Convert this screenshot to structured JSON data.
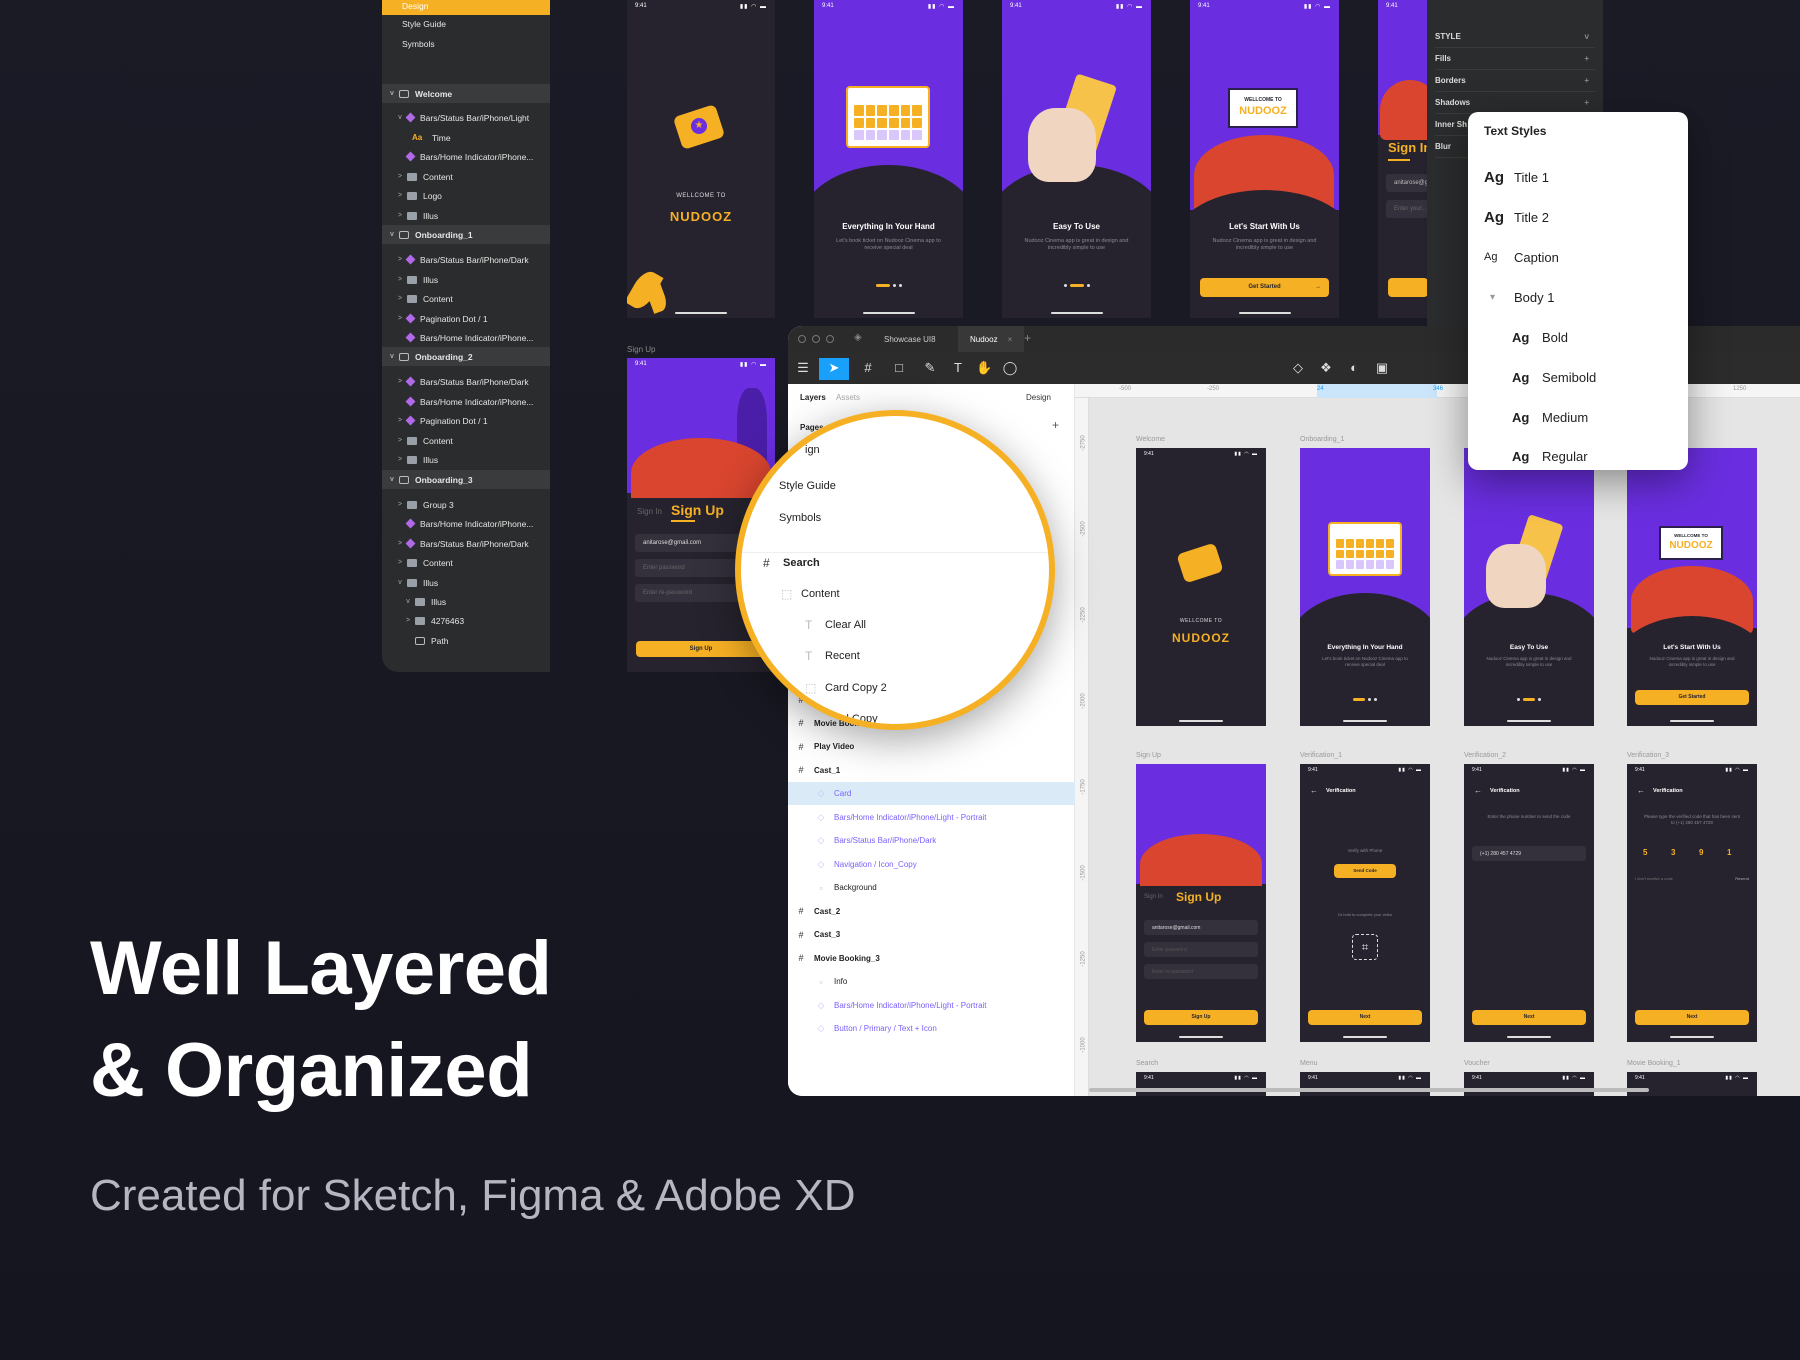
{
  "sketch_layers": {
    "top_selected": "Design",
    "pages": [
      "Style Guide",
      "Symbols"
    ],
    "rows": [
      {
        "type": "group",
        "label": "Welcome"
      },
      {
        "type": "symbol",
        "label": "Bars/Status Bar/iPhone/Light",
        "indent": 1,
        "arrow": "v"
      },
      {
        "type": "text",
        "label": "Time",
        "indent": 2
      },
      {
        "type": "symbol",
        "label": "Bars/Home Indicator/iPhone...",
        "indent": 1
      },
      {
        "type": "folder",
        "label": "Content",
        "indent": 1,
        "arrow": ">"
      },
      {
        "type": "folder",
        "label": "Logo",
        "indent": 1,
        "arrow": ">"
      },
      {
        "type": "folder",
        "label": "Illus",
        "indent": 1,
        "arrow": ">"
      },
      {
        "type": "group",
        "label": "Onboarding_1"
      },
      {
        "type": "symbol",
        "label": "Bars/Status Bar/iPhone/Dark",
        "indent": 1,
        "arrow": ">"
      },
      {
        "type": "folder",
        "label": "Illus",
        "indent": 1,
        "arrow": ">"
      },
      {
        "type": "folder",
        "label": "Content",
        "indent": 1,
        "arrow": ">"
      },
      {
        "type": "symbol",
        "label": "Pagination Dot / 1",
        "indent": 1,
        "arrow": ">"
      },
      {
        "type": "symbol",
        "label": "Bars/Home Indicator/iPhone...",
        "indent": 1
      },
      {
        "type": "group",
        "label": "Onboarding_2"
      },
      {
        "type": "symbol",
        "label": "Bars/Status Bar/iPhone/Dark",
        "indent": 1,
        "arrow": ">"
      },
      {
        "type": "symbol",
        "label": "Bars/Home Indicator/iPhone...",
        "indent": 1
      },
      {
        "type": "symbol",
        "label": "Pagination Dot / 1",
        "indent": 1,
        "arrow": ">"
      },
      {
        "type": "folder",
        "label": "Content",
        "indent": 1,
        "arrow": ">"
      },
      {
        "type": "folder",
        "label": "Illus",
        "indent": 1,
        "arrow": ">"
      },
      {
        "type": "group",
        "label": "Onboarding_3"
      },
      {
        "type": "folder",
        "label": "Group 3",
        "indent": 1,
        "arrow": ">"
      },
      {
        "type": "symbol",
        "label": "Bars/Home Indicator/iPhone...",
        "indent": 1
      },
      {
        "type": "symbol",
        "label": "Bars/Status Bar/iPhone/Dark",
        "indent": 1,
        "arrow": ">"
      },
      {
        "type": "folder",
        "label": "Content",
        "indent": 1,
        "arrow": ">"
      },
      {
        "type": "folder",
        "label": "Illus",
        "indent": 1,
        "arrow": "v"
      },
      {
        "type": "folder",
        "label": "Illus",
        "indent": 2,
        "arrow": "v"
      },
      {
        "type": "folder",
        "label": "4276463",
        "indent": 2,
        "arrow": ">"
      },
      {
        "type": "path",
        "label": "Path",
        "indent": 2
      }
    ]
  },
  "phones_top": {
    "status_time": "9:41",
    "welcome_small": "WELLCOME TO",
    "brand": "NUDOOZ",
    "onb1_title": "Everything In Your Hand",
    "onb1_desc": "Let's book ticket on Nudooz Cinema app to receive special deal",
    "onb2_title": "Easy To Use",
    "onb2_desc": "Nudooz Cinema app is great in design and incredibly simple to use",
    "onb3_title": "Let's Start With Us",
    "onb3_desc": "Nudooz Cinema app is great in design and incredibly simple to use",
    "get_started": "Get Started",
    "sign_up_frame_label": "Sign Up",
    "sign_in_tab": "Sign In",
    "sign_up_tab": "Sign Up",
    "email": "anitarose@gmail.com",
    "password_ph": "Enter password",
    "repassword_ph": "Enter re-password",
    "sign_up_btn": "Sign Up",
    "enter_ph": "Enter your..."
  },
  "figma": {
    "tabs": [
      "Showcase UI8",
      "Nudooz"
    ],
    "left_tabs": [
      "Layers",
      "Assets"
    ],
    "design_label": "Design",
    "pages_label": "Pages",
    "layers": [
      {
        "label": "Movie Booking_1",
        "kind": "frame"
      },
      {
        "label": "Movie Booking_2",
        "kind": "frame"
      },
      {
        "label": "Play Video",
        "kind": "frame"
      },
      {
        "label": "Cast_1",
        "kind": "frame"
      },
      {
        "label": "Card",
        "kind": "child-sel"
      },
      {
        "label": "Bars/Home Indicator/iPhone/Light - Portrait",
        "kind": "child"
      },
      {
        "label": "Bars/Status Bar/iPhone/Dark",
        "kind": "child"
      },
      {
        "label": "Navigation / Icon_Copy",
        "kind": "child"
      },
      {
        "label": "Background",
        "kind": "plain"
      },
      {
        "label": "Cast_2",
        "kind": "frame"
      },
      {
        "label": "Cast_3",
        "kind": "frame"
      },
      {
        "label": "Movie Booking_3",
        "kind": "frame"
      },
      {
        "label": "Info",
        "kind": "plain"
      },
      {
        "label": "Bars/Home Indicator/iPhone/Light - Portrait",
        "kind": "child"
      },
      {
        "label": "Button / Primary / Text + Icon",
        "kind": "child"
      }
    ],
    "ruler_top": [
      "-500",
      "-250",
      "24",
      "346",
      "1250"
    ],
    "ruler_left": [
      "-2750",
      "-2500",
      "-2250",
      "-2000",
      "-1750",
      "-1500",
      "-1250",
      "-1000"
    ],
    "frame_labels_row1": [
      "Welcome",
      "Onboarding_1",
      "",
      ""
    ],
    "frame_labels_row2": [
      "Sign Up",
      "Verification_1",
      "Verification_2",
      "Verification_3"
    ],
    "frame_labels_row3": [
      "Search",
      "Menu",
      "Voucher",
      "Movie Booking_1"
    ],
    "verification_title": "Verification",
    "verify_with_phone": "Verify with Phone",
    "send_code": "Send Code",
    "or_face": "Or hold to complete your video",
    "enter_phone_desc": "Enter the phone number to send the code",
    "phone_value": "(+1) 280 457 4729",
    "enter_code_desc": "Please type the verified code that has been sent to (+1) 280 457 4729",
    "code_digits": [
      "5",
      "3",
      "9",
      "1"
    ],
    "didnt_receive": "I don't receive a code",
    "resend": "Resend",
    "next": "Next"
  },
  "magnifier": {
    "top_partial": "ign",
    "items": [
      {
        "label": "Style Guide",
        "kind": "page"
      },
      {
        "label": "Symbols",
        "kind": "page"
      },
      {
        "label": "Search",
        "kind": "frame"
      },
      {
        "label": "Content",
        "kind": "group"
      },
      {
        "label": "Clear All",
        "kind": "text"
      },
      {
        "label": "Recent",
        "kind": "text"
      },
      {
        "label": "Card Copy 2",
        "kind": "group"
      },
      {
        "label": "Card Copy",
        "kind": "group"
      }
    ]
  },
  "inspector": {
    "rows": [
      "STYLE",
      "Fills",
      "Borders",
      "Shadows",
      "Inner Sh",
      "Blur"
    ]
  },
  "text_styles": {
    "title": "Text Styles",
    "rows": [
      {
        "label": "Title 1",
        "indent": 0
      },
      {
        "label": "Title 2",
        "indent": 0
      },
      {
        "label": "Caption",
        "indent": 0
      },
      {
        "label": "Body 1",
        "indent": 0,
        "group": true
      },
      {
        "label": "Bold",
        "indent": 1
      },
      {
        "label": "Semibold",
        "indent": 1
      },
      {
        "label": "Medium",
        "indent": 1
      },
      {
        "label": "Regular",
        "indent": 1
      }
    ],
    "ag": "Ag"
  },
  "headline": {
    "line1": "Well Layered",
    "line2": "& Organized",
    "subtitle": "Created for Sketch, Figma & Adobe XD"
  },
  "colors": {
    "accent": "#f6b024",
    "purple": "#6a2ee0",
    "dark": "#26232e",
    "figma_blue": "#18a0fb"
  }
}
